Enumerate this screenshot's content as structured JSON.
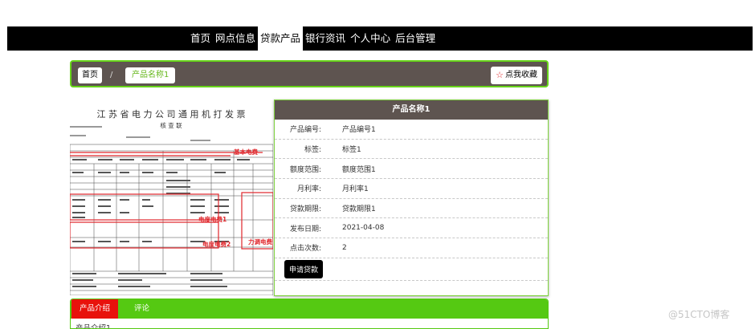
{
  "nav": {
    "items": [
      {
        "label": "首页"
      },
      {
        "label": "网点信息"
      },
      {
        "label": "贷款产品"
      },
      {
        "label": "银行资讯"
      },
      {
        "label": "个人中心"
      },
      {
        "label": "后台管理"
      }
    ],
    "active_index": 2
  },
  "breadcrumb": {
    "home": "首页",
    "separator": "/",
    "current": "产品名称1",
    "favorite_label": "点我收藏",
    "favorite_icon": "star-outline-icon"
  },
  "document_image": {
    "title": "江 苏 省 电 力 公 司 通 用 机 打 发 票",
    "subtitle": "核 查 联",
    "annotations": [
      "基本电费",
      "电度电费1",
      "电度电费2",
      "力调电费"
    ]
  },
  "detail": {
    "title": "产品名称1",
    "rows": [
      {
        "label": "产品编号:",
        "value": "产品编号1"
      },
      {
        "label": "标签:",
        "value": "标签1"
      },
      {
        "label": "额度范围:",
        "value": "额度范围1"
      },
      {
        "label": "月利率:",
        "value": "月利率1"
      },
      {
        "label": "贷款期限:",
        "value": "贷款期限1"
      },
      {
        "label": "发布日期:",
        "value": "2021-04-08"
      },
      {
        "label": "点击次数:",
        "value": "2"
      }
    ],
    "apply_label": "申请贷款"
  },
  "tabs": {
    "items": [
      {
        "label": "产品介绍"
      },
      {
        "label": "评论"
      }
    ],
    "content": "产品介绍1"
  },
  "watermark": "@51CTO博客",
  "colors": {
    "accent_green": "#55c912",
    "header_brown": "#5e5450",
    "tab_active_red": "#e8120c",
    "annotation_red": "#e0262b"
  }
}
